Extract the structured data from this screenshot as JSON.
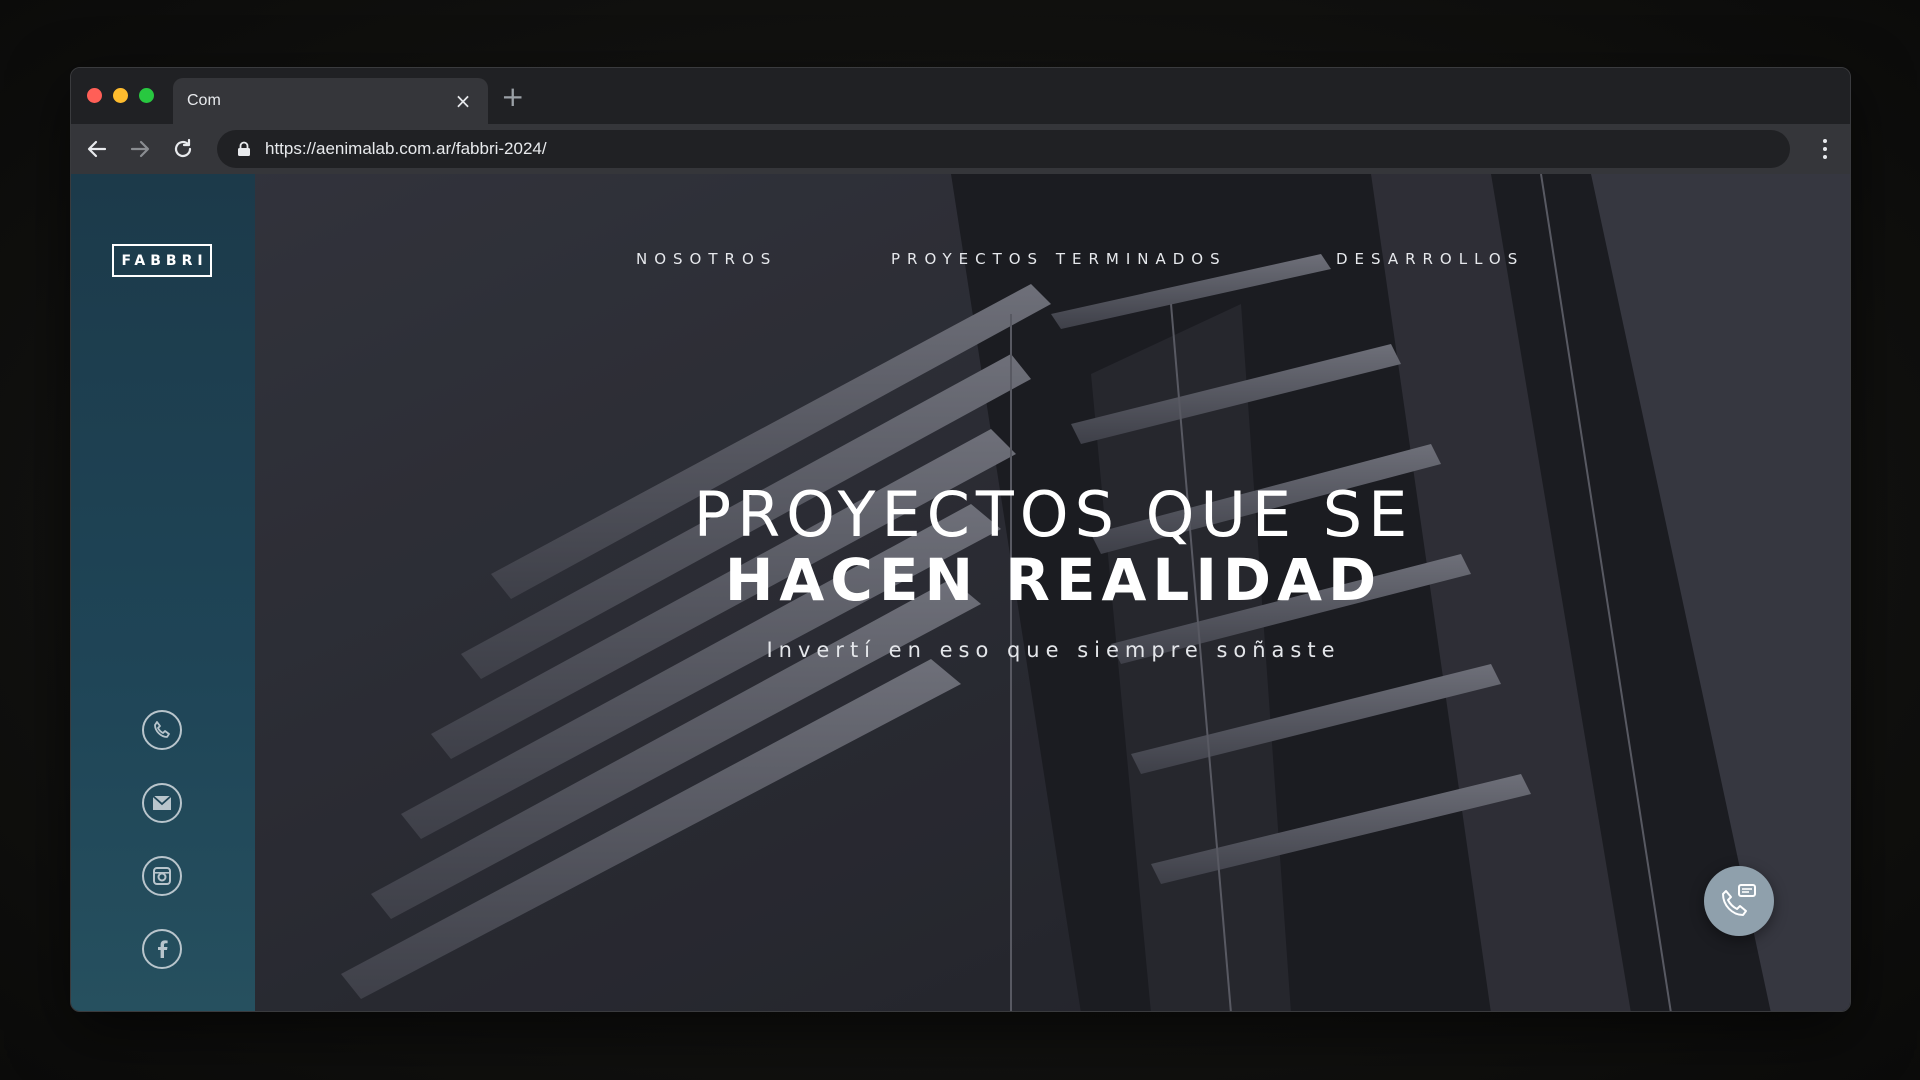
{
  "browser": {
    "tab_title": "Com",
    "tab_close": "×",
    "new_tab": "+",
    "url": "https://aenimalab.com.ar/fabbri-2024/"
  },
  "site": {
    "logo": "FABBRI",
    "nav": [
      "NOSOTROS",
      "PROYECTOS TERMINADOS",
      "DESARROLLOS"
    ],
    "hero": {
      "line1": "PROYECTOS QUE SE",
      "line2": "HACEN REALIDAD",
      "subtitle": "Invertí en eso que siempre soñaste"
    },
    "social_icons": [
      "phone-icon",
      "mail-icon",
      "instagram-icon",
      "facebook-icon"
    ],
    "chat_icon": "phone-chat-icon"
  },
  "colors": {
    "sidebar": "#1f4557",
    "fab": "#8fa0ac"
  }
}
